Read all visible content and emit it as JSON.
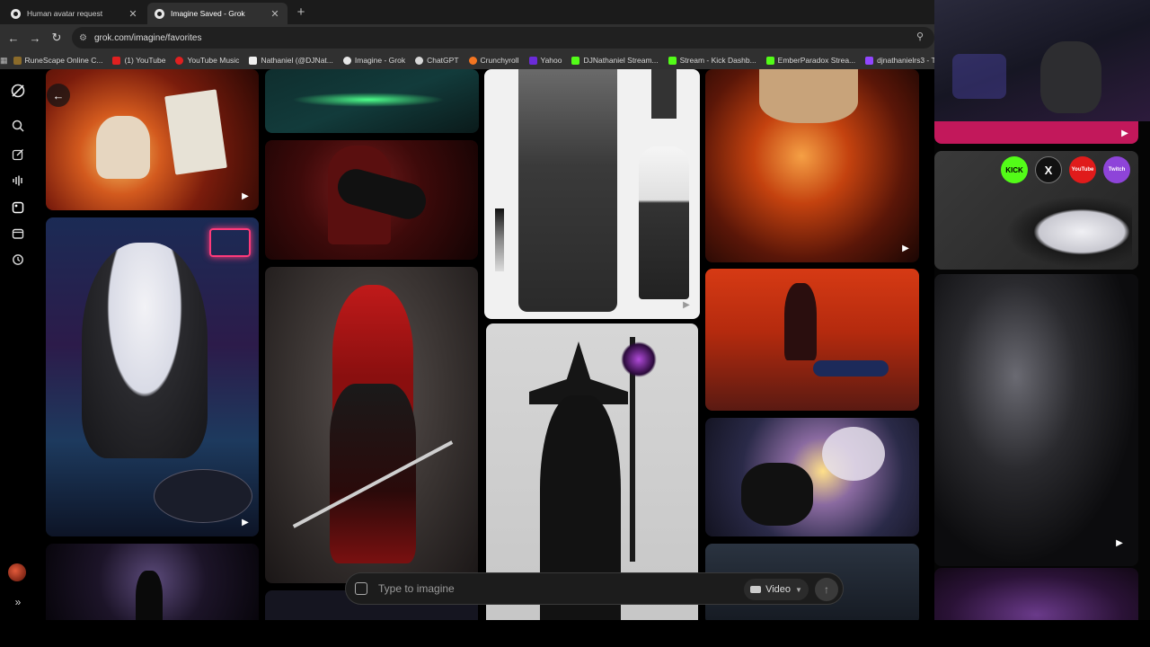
{
  "browser": {
    "tabs": [
      {
        "title": "Human avatar request",
        "active": false
      },
      {
        "title": "Imagine Saved - Grok",
        "active": true
      }
    ],
    "url": "grok.com/imagine/favorites",
    "bookmarks": [
      {
        "label": "RuneScape Online C...",
        "color": "#8b6b2a"
      },
      {
        "label": "(1) YouTube",
        "color": "#e02020"
      },
      {
        "label": "YouTube Music",
        "color": "#e02020"
      },
      {
        "label": "Nathaniel (@DJNat...",
        "color": "#f0f0f0"
      },
      {
        "label": "Imagine - Grok",
        "color": "#e6e6e6"
      },
      {
        "label": "ChatGPT",
        "color": "#d8d8d8"
      },
      {
        "label": "Crunchyroll",
        "color": "#f47521"
      },
      {
        "label": "Yahoo",
        "color": "#6b2bd9"
      },
      {
        "label": "DJNathaniel Stream...",
        "color": "#53fc18"
      },
      {
        "label": "Stream - Kick Dashb...",
        "color": "#53fc18"
      },
      {
        "label": "EmberParadox Strea...",
        "color": "#53fc18"
      },
      {
        "label": "djnathanielrs3 - Twit...",
        "color": "#9146ff"
      }
    ]
  },
  "prompt": {
    "placeholder": "Type to imagine",
    "mode_label": "Video"
  },
  "social_overlay": {
    "kick": "KICK",
    "x": "X",
    "youtube": "YouTube",
    "twitch": "Twitch"
  },
  "sidebar_icons": [
    "grok-logo-icon",
    "search-icon",
    "edit-icon",
    "voice-icon",
    "imagine-icon",
    "projects-icon",
    "history-icon",
    "expand-icon"
  ]
}
